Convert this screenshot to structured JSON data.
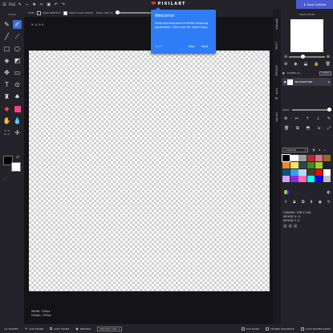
{
  "topbar": {
    "file_label": "FILE",
    "icons": [
      "pencil-icon",
      "eyedropper-icon",
      "move-icon",
      "cut-icon",
      "bucket-icon",
      "undo-icon",
      "redo-icon"
    ],
    "brand": "PIXILART",
    "save_label": "Save Untitled"
  },
  "options": {
    "pixel_label": "PIXEL",
    "pixel_perfect": "PIXEL PERFECT",
    "right_click_erase": "RIGHT CLICK ERASE",
    "pixel_size": "PIXEL SIZE (1)"
  },
  "tools": {
    "title": "TOOLS",
    "items": [
      "pencil",
      "eraser",
      "line",
      "circle",
      "bucket",
      "rect-select",
      "move",
      "rectangle",
      "text",
      "lasso",
      "stamp",
      "dither",
      "eraser-color",
      "gradient",
      "smudge",
      "eyedropper",
      "selection",
      "pan"
    ]
  },
  "canvas": {
    "coords": "X: 0, Y: 0",
    "width_label": "Width: 100px",
    "height_label": "Height: 100px"
  },
  "bottombar": {
    "frames": "1/1 FRAMES",
    "add_frame": "ADD FRAME",
    "copy_frame": "COPY FRAME",
    "preview": "PREVIEW",
    "preview_size": "PREVIEW SIZE",
    "tile_mode": "TILE MODE",
    "frames_sequence": "FRAMES SEQUENCE",
    "lock_frames": "LOCK FRAMES ROWS"
  },
  "sidetabs": [
    "PREVIEW",
    "LAYER",
    "OPTIONS",
    "TOOL",
    "COLORS"
  ],
  "rpanel": {
    "nav_title": "NAVIGATION",
    "layers_label": "LAYERS (1)",
    "filter_label": "FILTERS",
    "layer_name": "BACKGROUND",
    "opacity": "100%",
    "palette": "COMMON",
    "canvas_size": "CANVAS: 256 X 144",
    "mouse_x": "MOUSE X: 0,",
    "mouse_y": "MOUSE Y: 0"
  },
  "palette_colors": [
    "#000000",
    "#ffffff",
    "#9d9d9d",
    "#be2633",
    "#e06f8b",
    "#a46422",
    "#eb8931",
    "#f7e26b",
    "#2f484e",
    "#44891a",
    "#a3ce27",
    "#1b2632",
    "#005784",
    "#31a2f2",
    "#b2dcef",
    "#493c2b",
    "#ff0000",
    "#ffffff",
    "#d4a5ff",
    "#8a2be2",
    "#ff69b4",
    "#00ffff",
    "#0000ff",
    "#c0c0c0"
  ],
  "popup": {
    "title": "Welcome!",
    "body": "Hello and welcome to Pixilart drawing application. Click next for helpful tips.",
    "back": "Back",
    "skip": "Skip",
    "next": "Next"
  }
}
